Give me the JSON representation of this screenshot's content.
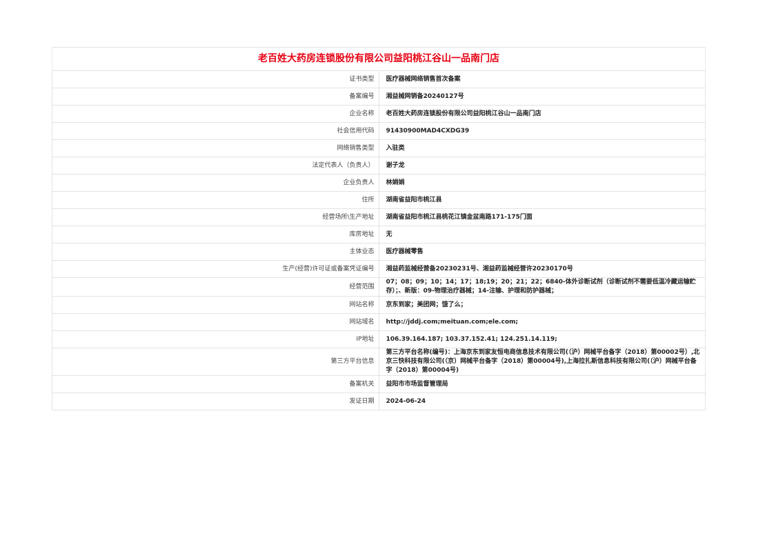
{
  "title": "老百姓大药房连锁股份有限公司益阳桃江谷山一品南门店",
  "rows": [
    {
      "label": "证书类型",
      "value": "医疗器械网络销售首次备案"
    },
    {
      "label": "备案编号",
      "value": "湘益械网销备20240127号"
    },
    {
      "label": "企业名称",
      "value": "老百姓大药房连锁股份有限公司益阳桃江谷山一品南门店"
    },
    {
      "label": "社会信用代码",
      "value": "91430900MAD4CXDG39"
    },
    {
      "label": "网络销售类型",
      "value": "入驻类"
    },
    {
      "label": "法定代表人（负责人）",
      "value": "谢子龙"
    },
    {
      "label": "企业负责人",
      "value": "林娟娟"
    },
    {
      "label": "住所",
      "value": "湖南省益阳市桃江县"
    },
    {
      "label": "经营场所\\生产地址",
      "value": "湖南省益阳市桃江县桃花江镇金盆南路171-175门面"
    },
    {
      "label": "库房地址",
      "value": "无"
    },
    {
      "label": "主体业态",
      "value": "医疗器械零售"
    },
    {
      "label": "生产(经营)许可证或备案凭证编号",
      "value": "湘益药监械经营备20230231号、湘益药监械经营许20230170号"
    },
    {
      "label": "经营范围",
      "value": "07；08；09；10；14；17；18;19；20；21；22；6840-体外诊断试剂（诊断试剂不需要低温冷藏运输贮存）；、新版：09-物理治疗器械；14-注输、护理和防护器械；"
    },
    {
      "label": "网站名称",
      "value": "京东到家；美团网；饿了么；"
    },
    {
      "label": "网站域名",
      "value": "http://jddj.com;meituan.com;ele.com;"
    },
    {
      "label": "IP地址",
      "value": "106.39.164.187; 103.37.152.41; 124.251.14.119;"
    },
    {
      "label": "第三方平台信息",
      "value": "第三方平台名称(编号)：上海京东到家友恒电商信息技术有限公司(（沪）网械平台备字（2018）第00002号）,北京三快科技有限公司(（京）网械平台备字（2018）第00004号),上海拉扎斯信息科技有限公司(（沪）网械平台备字（2018）第00004号)"
    },
    {
      "label": "备案机关",
      "value": "益阳市市场监督管理局"
    },
    {
      "label": "发证日期",
      "value": "2024-06-24"
    }
  ]
}
